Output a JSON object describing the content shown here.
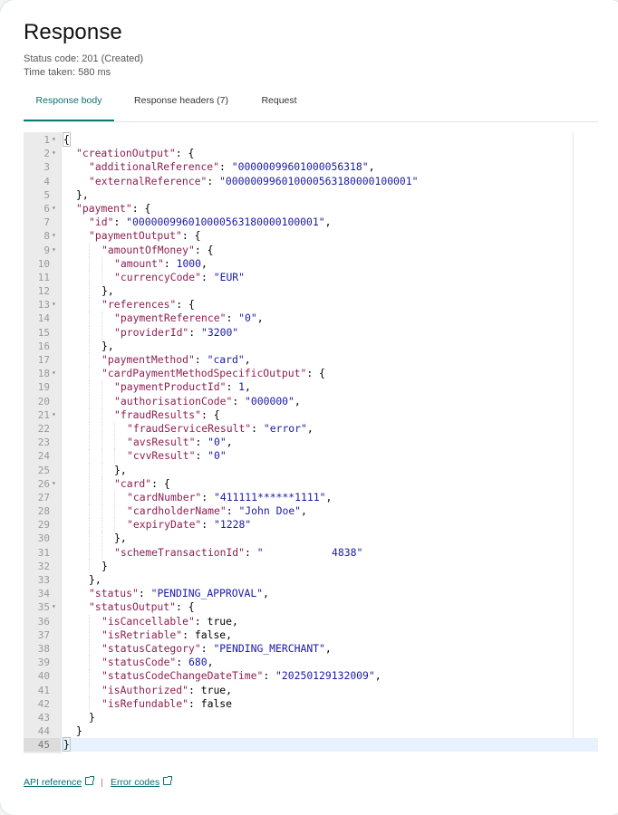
{
  "header": {
    "title": "Response",
    "status": "Status code: 201 (Created)",
    "time": "Time taken: 580 ms"
  },
  "tabs": [
    {
      "label": "Response body",
      "active": true
    },
    {
      "label": "Response headers (7)",
      "active": false
    },
    {
      "label": "Request",
      "active": false
    }
  ],
  "colors": {
    "accent": "#0b7a78",
    "json_key": "#8f1f52",
    "json_string": "#1a1aa6",
    "active_line": "#e8f2fe"
  },
  "editor": {
    "active_line": 45,
    "lines": [
      {
        "n": 1,
        "fold": true,
        "indent": 0,
        "tokens": [
          [
            "p",
            "{"
          ]
        ]
      },
      {
        "n": 2,
        "fold": true,
        "indent": 1,
        "tokens": [
          [
            "k",
            "\"creationOutput\""
          ],
          [
            "p",
            ": {"
          ]
        ]
      },
      {
        "n": 3,
        "fold": false,
        "indent": 2,
        "tokens": [
          [
            "k",
            "\"additionalReference\""
          ],
          [
            "p",
            ": "
          ],
          [
            "s",
            "\"00000099601000056318\""
          ],
          [
            "p",
            ","
          ]
        ]
      },
      {
        "n": 4,
        "fold": false,
        "indent": 2,
        "tokens": [
          [
            "k",
            "\"externalReference\""
          ],
          [
            "p",
            ": "
          ],
          [
            "s",
            "\"000000996010000563180000100001\""
          ]
        ]
      },
      {
        "n": 5,
        "fold": false,
        "indent": 1,
        "tokens": [
          [
            "p",
            "},"
          ]
        ]
      },
      {
        "n": 6,
        "fold": true,
        "indent": 1,
        "tokens": [
          [
            "k",
            "\"payment\""
          ],
          [
            "p",
            ": {"
          ]
        ]
      },
      {
        "n": 7,
        "fold": false,
        "indent": 2,
        "tokens": [
          [
            "k",
            "\"id\""
          ],
          [
            "p",
            ": "
          ],
          [
            "s",
            "\"000000996010000563180000100001\""
          ],
          [
            "p",
            ","
          ]
        ]
      },
      {
        "n": 8,
        "fold": true,
        "indent": 2,
        "tokens": [
          [
            "k",
            "\"paymentOutput\""
          ],
          [
            "p",
            ": {"
          ]
        ]
      },
      {
        "n": 9,
        "fold": true,
        "indent": 3,
        "tokens": [
          [
            "k",
            "\"amountOfMoney\""
          ],
          [
            "p",
            ": {"
          ]
        ]
      },
      {
        "n": 10,
        "fold": false,
        "indent": 4,
        "tokens": [
          [
            "k",
            "\"amount\""
          ],
          [
            "p",
            ": "
          ],
          [
            "n",
            "1000"
          ],
          [
            "p",
            ","
          ]
        ]
      },
      {
        "n": 11,
        "fold": false,
        "indent": 4,
        "tokens": [
          [
            "k",
            "\"currencyCode\""
          ],
          [
            "p",
            ": "
          ],
          [
            "s",
            "\"EUR\""
          ]
        ]
      },
      {
        "n": 12,
        "fold": false,
        "indent": 3,
        "tokens": [
          [
            "p",
            "},"
          ]
        ]
      },
      {
        "n": 13,
        "fold": true,
        "indent": 3,
        "tokens": [
          [
            "k",
            "\"references\""
          ],
          [
            "p",
            ": {"
          ]
        ]
      },
      {
        "n": 14,
        "fold": false,
        "indent": 4,
        "tokens": [
          [
            "k",
            "\"paymentReference\""
          ],
          [
            "p",
            ": "
          ],
          [
            "s",
            "\"0\""
          ],
          [
            "p",
            ","
          ]
        ]
      },
      {
        "n": 15,
        "fold": false,
        "indent": 4,
        "tokens": [
          [
            "k",
            "\"providerId\""
          ],
          [
            "p",
            ": "
          ],
          [
            "s",
            "\"3200\""
          ]
        ]
      },
      {
        "n": 16,
        "fold": false,
        "indent": 3,
        "tokens": [
          [
            "p",
            "},"
          ]
        ]
      },
      {
        "n": 17,
        "fold": false,
        "indent": 3,
        "tokens": [
          [
            "k",
            "\"paymentMethod\""
          ],
          [
            "p",
            ": "
          ],
          [
            "s",
            "\"card\""
          ],
          [
            "p",
            ","
          ]
        ]
      },
      {
        "n": 18,
        "fold": true,
        "indent": 3,
        "tokens": [
          [
            "k",
            "\"cardPaymentMethodSpecificOutput\""
          ],
          [
            "p",
            ": {"
          ]
        ]
      },
      {
        "n": 19,
        "fold": false,
        "indent": 4,
        "tokens": [
          [
            "k",
            "\"paymentProductId\""
          ],
          [
            "p",
            ": "
          ],
          [
            "n",
            "1"
          ],
          [
            "p",
            ","
          ]
        ]
      },
      {
        "n": 20,
        "fold": false,
        "indent": 4,
        "tokens": [
          [
            "k",
            "\"authorisationCode\""
          ],
          [
            "p",
            ": "
          ],
          [
            "s",
            "\"000000\""
          ],
          [
            "p",
            ","
          ]
        ]
      },
      {
        "n": 21,
        "fold": true,
        "indent": 4,
        "tokens": [
          [
            "k",
            "\"fraudResults\""
          ],
          [
            "p",
            ": {"
          ]
        ]
      },
      {
        "n": 22,
        "fold": false,
        "indent": 5,
        "tokens": [
          [
            "k",
            "\"fraudServiceResult\""
          ],
          [
            "p",
            ": "
          ],
          [
            "s",
            "\"error\""
          ],
          [
            "p",
            ","
          ]
        ]
      },
      {
        "n": 23,
        "fold": false,
        "indent": 5,
        "tokens": [
          [
            "k",
            "\"avsResult\""
          ],
          [
            "p",
            ": "
          ],
          [
            "s",
            "\"0\""
          ],
          [
            "p",
            ","
          ]
        ]
      },
      {
        "n": 24,
        "fold": false,
        "indent": 5,
        "tokens": [
          [
            "k",
            "\"cvvResult\""
          ],
          [
            "p",
            ": "
          ],
          [
            "s",
            "\"0\""
          ]
        ]
      },
      {
        "n": 25,
        "fold": false,
        "indent": 4,
        "tokens": [
          [
            "p",
            "},"
          ]
        ]
      },
      {
        "n": 26,
        "fold": true,
        "indent": 4,
        "tokens": [
          [
            "k",
            "\"card\""
          ],
          [
            "p",
            ": {"
          ]
        ]
      },
      {
        "n": 27,
        "fold": false,
        "indent": 5,
        "tokens": [
          [
            "k",
            "\"cardNumber\""
          ],
          [
            "p",
            ": "
          ],
          [
            "s",
            "\"411111******1111\""
          ],
          [
            "p",
            ","
          ]
        ]
      },
      {
        "n": 28,
        "fold": false,
        "indent": 5,
        "tokens": [
          [
            "k",
            "\"cardholderName\""
          ],
          [
            "p",
            ": "
          ],
          [
            "s",
            "\"John Doe\""
          ],
          [
            "p",
            ","
          ]
        ]
      },
      {
        "n": 29,
        "fold": false,
        "indent": 5,
        "tokens": [
          [
            "k",
            "\"expiryDate\""
          ],
          [
            "p",
            ": "
          ],
          [
            "s",
            "\"1228\""
          ]
        ]
      },
      {
        "n": 30,
        "fold": false,
        "indent": 4,
        "tokens": [
          [
            "p",
            "},"
          ]
        ]
      },
      {
        "n": 31,
        "fold": false,
        "indent": 4,
        "tokens": [
          [
            "k",
            "\"schemeTransactionId\""
          ],
          [
            "p",
            ": "
          ],
          [
            "s",
            "\"           4838\""
          ]
        ]
      },
      {
        "n": 32,
        "fold": false,
        "indent": 3,
        "tokens": [
          [
            "p",
            "}"
          ]
        ]
      },
      {
        "n": 33,
        "fold": false,
        "indent": 2,
        "tokens": [
          [
            "p",
            "},"
          ]
        ]
      },
      {
        "n": 34,
        "fold": false,
        "indent": 2,
        "tokens": [
          [
            "k",
            "\"status\""
          ],
          [
            "p",
            ": "
          ],
          [
            "s",
            "\"PENDING_APPROVAL\""
          ],
          [
            "p",
            ","
          ]
        ]
      },
      {
        "n": 35,
        "fold": true,
        "indent": 2,
        "tokens": [
          [
            "k",
            "\"statusOutput\""
          ],
          [
            "p",
            ": {"
          ]
        ]
      },
      {
        "n": 36,
        "fold": false,
        "indent": 3,
        "tokens": [
          [
            "k",
            "\"isCancellable\""
          ],
          [
            "p",
            ": "
          ],
          [
            "b",
            "true"
          ],
          [
            "p",
            ","
          ]
        ]
      },
      {
        "n": 37,
        "fold": false,
        "indent": 3,
        "tokens": [
          [
            "k",
            "\"isRetriable\""
          ],
          [
            "p",
            ": "
          ],
          [
            "b",
            "false"
          ],
          [
            "p",
            ","
          ]
        ]
      },
      {
        "n": 38,
        "fold": false,
        "indent": 3,
        "tokens": [
          [
            "k",
            "\"statusCategory\""
          ],
          [
            "p",
            ": "
          ],
          [
            "s",
            "\"PENDING_MERCHANT\""
          ],
          [
            "p",
            ","
          ]
        ]
      },
      {
        "n": 39,
        "fold": false,
        "indent": 3,
        "tokens": [
          [
            "k",
            "\"statusCode\""
          ],
          [
            "p",
            ": "
          ],
          [
            "n",
            "680"
          ],
          [
            "p",
            ","
          ]
        ]
      },
      {
        "n": 40,
        "fold": false,
        "indent": 3,
        "tokens": [
          [
            "k",
            "\"statusCodeChangeDateTime\""
          ],
          [
            "p",
            ": "
          ],
          [
            "s",
            "\"20250129132009\""
          ],
          [
            "p",
            ","
          ]
        ]
      },
      {
        "n": 41,
        "fold": false,
        "indent": 3,
        "tokens": [
          [
            "k",
            "\"isAuthorized\""
          ],
          [
            "p",
            ": "
          ],
          [
            "b",
            "true"
          ],
          [
            "p",
            ","
          ]
        ]
      },
      {
        "n": 42,
        "fold": false,
        "indent": 3,
        "tokens": [
          [
            "k",
            "\"isRefundable\""
          ],
          [
            "p",
            ": "
          ],
          [
            "b",
            "false"
          ]
        ]
      },
      {
        "n": 43,
        "fold": false,
        "indent": 2,
        "tokens": [
          [
            "p",
            "}"
          ]
        ]
      },
      {
        "n": 44,
        "fold": false,
        "indent": 1,
        "tokens": [
          [
            "p",
            "}"
          ]
        ]
      },
      {
        "n": 45,
        "fold": false,
        "indent": 0,
        "tokens": [
          [
            "p",
            "}"
          ]
        ]
      }
    ]
  },
  "footer": {
    "links": [
      {
        "label": "API reference",
        "icon": "external-link-icon"
      },
      {
        "label": "Error codes",
        "icon": "external-link-icon"
      }
    ],
    "separator": "|"
  }
}
